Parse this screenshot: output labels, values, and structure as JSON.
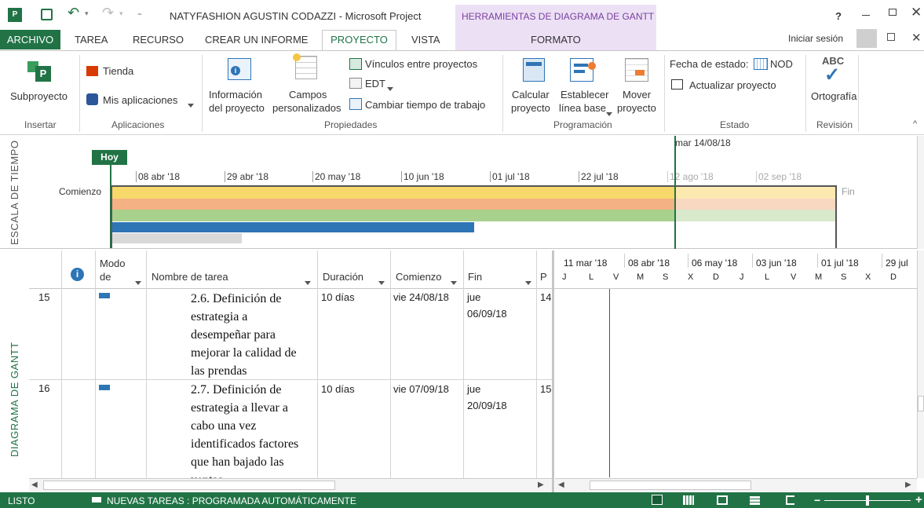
{
  "app": {
    "title": "NATYFASHION AGUSTIN CODAZZI - Microsoft Project",
    "context_tab": "HERRAMIENTAS DE DIAGRAMA DE GANTT",
    "signin": "Iniciar sesión",
    "help": "?"
  },
  "tabs": {
    "archivo": "ARCHIVO",
    "tarea": "TAREA",
    "recurso": "RECURSO",
    "informe": "CREAR UN INFORME",
    "proyecto": "PROYECTO",
    "vista": "VISTA",
    "formato": "FORMATO"
  },
  "ribbon": {
    "subproyecto": "Subproyecto",
    "tienda": "Tienda",
    "mis_apps": "Mis aplicaciones",
    "info1": "Información",
    "info2": "del proyecto",
    "campos1": "Campos",
    "campos2": "personalizados",
    "vinculos": "Vínculos entre proyectos",
    "edt": "EDT",
    "cambiar": "Cambiar tiempo de trabajo",
    "calc1": "Calcular",
    "calc2": "proyecto",
    "est1": "Establecer",
    "est2": "línea base",
    "mover1": "Mover",
    "mover2": "proyecto",
    "fecha": "Fecha de estado:",
    "nod": "NOD",
    "actualizar": "Actualizar proyecto",
    "abc": "ABC",
    "ortografia": "Ortografía",
    "groups": {
      "insertar": "Insertar",
      "aplicaciones": "Aplicaciones",
      "propiedades": "Propiedades",
      "programacion": "Programación",
      "estado": "Estado",
      "revision": "Revisión"
    }
  },
  "timeline": {
    "side_label": "ESCALA DE TIEMPO",
    "hoy": "Hoy",
    "date_marker": "mar 14/08/18",
    "comienzo": "Comienzo",
    "fin": "Fin",
    "ticks": [
      "08 abr '18",
      "29 abr '18",
      "20 may '18",
      "10 jun '18",
      "01 jul '18",
      "22 jul '18",
      "12 ago '18",
      "02 sep '18"
    ],
    "colors": {
      "yellow": "#f7d86a",
      "orange": "#f4b183",
      "green": "#a9d18e",
      "blue": "#2e75b6",
      "gray": "#d9d9d9",
      "status_line": "#217346"
    }
  },
  "gantt": {
    "side_label": "DIAGRAMA DE GANTT",
    "headers": {
      "info": "i",
      "modo1": "Modo",
      "modo2": "de",
      "nombre": "Nombre de tarea",
      "duracion": "Duración",
      "comienzo": "Comienzo",
      "fin": "Fin",
      "p": "P"
    },
    "chart_top": [
      "11 mar '18",
      "08 abr '18",
      "06 may '18",
      "03 jun '18",
      "01 jul '18",
      "29 jul"
    ],
    "chart_days": [
      "J",
      "L",
      "V",
      "M",
      "S",
      "X",
      "D",
      "J",
      "L",
      "V",
      "M",
      "S",
      "X",
      "D"
    ],
    "rows": [
      {
        "id": "15",
        "name_lines": [
          "2.6. Definición de",
          "estrategia a",
          "desempeñar para",
          "mejorar la calidad de",
          "las prendas"
        ],
        "duration": "10 días",
        "start": "vie 24/08/18",
        "end1": "jue",
        "end2": "06/09/18",
        "p": "14"
      },
      {
        "id": "16",
        "name_lines": [
          "2.7. Definición de",
          "estrategia a llevar a",
          "cabo una vez",
          "identificados factores",
          "que han bajado las",
          "ventas"
        ],
        "duration": "10 días",
        "start": "vie 07/09/18",
        "end1": "jue",
        "end2": "20/09/18",
        "p": "15"
      }
    ]
  },
  "status": {
    "listo": "LISTO",
    "nuevas": "NUEVAS TAREAS : PROGRAMADA AUTOMÁTICAMENTE"
  }
}
